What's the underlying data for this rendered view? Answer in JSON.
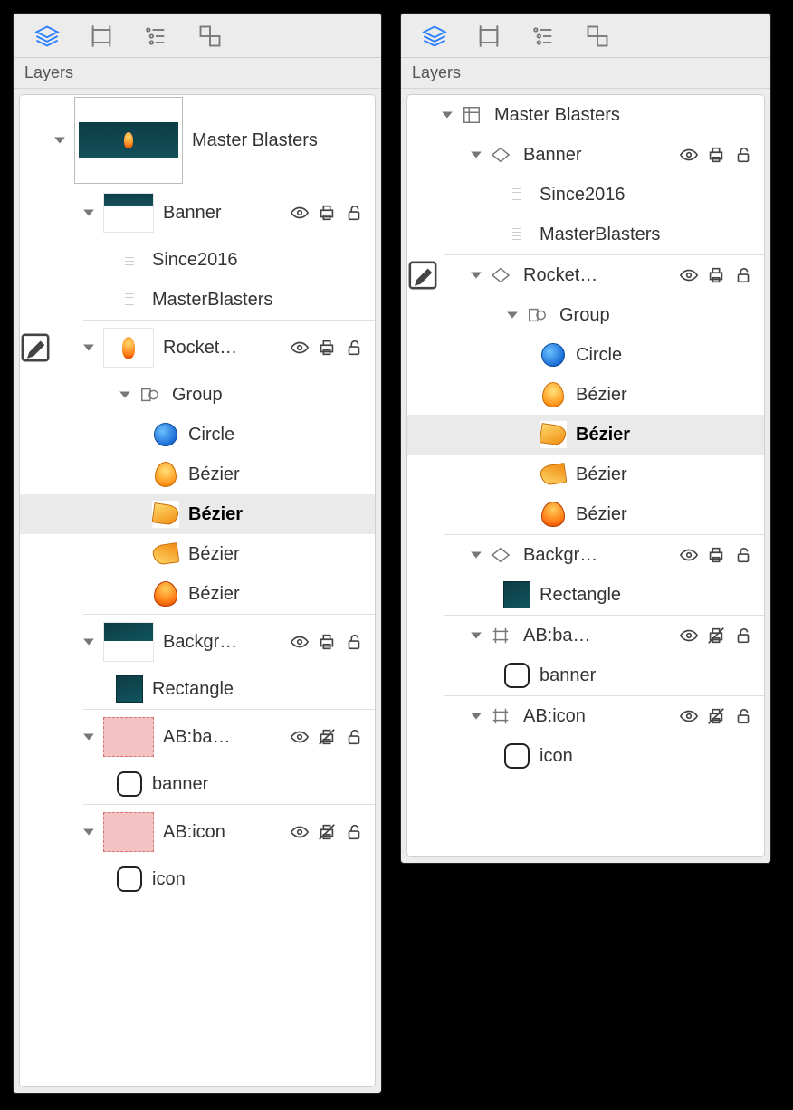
{
  "section_title": "Layers",
  "toolbar_icons": [
    "layers-icon",
    "artboard-icon",
    "outline-icon",
    "components-icon"
  ],
  "left": {
    "items": [
      {
        "id": "master",
        "label": "Master Blasters",
        "indent": 0,
        "disclosure": true,
        "thumb": "master-lg",
        "height": "tall"
      },
      {
        "id": "banner",
        "label": "Banner",
        "indent": 1,
        "disclosure": true,
        "thumb": "banner-md",
        "height": "med",
        "controls": [
          "eye",
          "print",
          "lock"
        ]
      },
      {
        "id": "since2016",
        "label": "Since2016",
        "indent": 2,
        "thumb": "text-mini"
      },
      {
        "id": "masterblasters",
        "label": "MasterBlasters",
        "indent": 2,
        "thumb": "text-mini"
      },
      {
        "id": "divider"
      },
      {
        "id": "rocket",
        "label": "Rocket…",
        "indent": 1,
        "disclosure": true,
        "thumb": "rocket-md",
        "height": "med",
        "editing": true,
        "controls": [
          "eye",
          "print",
          "lock"
        ]
      },
      {
        "id": "group",
        "label": "Group",
        "indent": 2,
        "disclosure": true,
        "type_icon": "group"
      },
      {
        "id": "circle",
        "label": "Circle",
        "indent": 3,
        "shape": "circle"
      },
      {
        "id": "bezier1",
        "label": "Bézier",
        "indent": 3,
        "shape": "drop"
      },
      {
        "id": "bezier2",
        "label": "Bézier",
        "indent": 3,
        "shape": "flame-l",
        "selected": true,
        "bold": true
      },
      {
        "id": "bezier3",
        "label": "Bézier",
        "indent": 3,
        "shape": "flame-r"
      },
      {
        "id": "bezier4",
        "label": "Bézier",
        "indent": 3,
        "shape": "fireball"
      },
      {
        "id": "divider"
      },
      {
        "id": "backgr",
        "label": "Backgr…",
        "indent": 1,
        "disclosure": true,
        "thumb": "bg-md",
        "height": "med",
        "controls": [
          "eye",
          "print",
          "lock"
        ]
      },
      {
        "id": "rectangle",
        "label": "Rectangle",
        "indent": 2,
        "shape": "rect-dark"
      },
      {
        "id": "divider"
      },
      {
        "id": "abba",
        "label": "AB:ba…",
        "indent": 1,
        "disclosure": true,
        "thumb": "pink",
        "height": "med",
        "controls": [
          "eye",
          "no-print",
          "lock"
        ]
      },
      {
        "id": "banner-slice",
        "label": "banner",
        "indent": 2,
        "shape": "roundrect"
      },
      {
        "id": "divider"
      },
      {
        "id": "abicon",
        "label": "AB:icon",
        "indent": 1,
        "disclosure": true,
        "thumb": "pink",
        "height": "med",
        "controls": [
          "eye",
          "no-print",
          "lock"
        ]
      },
      {
        "id": "icon-slice",
        "label": "icon",
        "indent": 2,
        "shape": "roundrect"
      }
    ]
  },
  "right": {
    "items": [
      {
        "id": "master",
        "label": "Master Blasters",
        "indent": 0,
        "disclosure": true,
        "type_icon": "canvas"
      },
      {
        "id": "banner",
        "label": "Banner",
        "indent": 1,
        "disclosure": true,
        "type_icon": "layer",
        "controls": [
          "eye",
          "print",
          "lock"
        ]
      },
      {
        "id": "since2016",
        "label": "Since2016",
        "indent": 2,
        "thumb": "text-mini"
      },
      {
        "id": "masterblasters",
        "label": "MasterBlasters",
        "indent": 2,
        "thumb": "text-mini"
      },
      {
        "id": "divider"
      },
      {
        "id": "rocket",
        "label": "Rocket…",
        "indent": 1,
        "disclosure": true,
        "type_icon": "layer",
        "editing": true,
        "controls": [
          "eye",
          "print",
          "lock"
        ]
      },
      {
        "id": "group",
        "label": "Group",
        "indent": 2,
        "disclosure": true,
        "type_icon": "group"
      },
      {
        "id": "circle",
        "label": "Circle",
        "indent": 3,
        "shape": "circle"
      },
      {
        "id": "bezier1",
        "label": "Bézier",
        "indent": 3,
        "shape": "drop"
      },
      {
        "id": "bezier2",
        "label": "Bézier",
        "indent": 3,
        "shape": "flame-l",
        "selected": true,
        "bold": true
      },
      {
        "id": "bezier3",
        "label": "Bézier",
        "indent": 3,
        "shape": "flame-r"
      },
      {
        "id": "bezier4",
        "label": "Bézier",
        "indent": 3,
        "shape": "fireball"
      },
      {
        "id": "divider"
      },
      {
        "id": "backgr",
        "label": "Backgr…",
        "indent": 1,
        "disclosure": true,
        "type_icon": "layer",
        "controls": [
          "eye",
          "print",
          "lock"
        ]
      },
      {
        "id": "rectangle",
        "label": "Rectangle",
        "indent": 2,
        "shape": "rect-dark"
      },
      {
        "id": "divider"
      },
      {
        "id": "abba",
        "label": "AB:ba…",
        "indent": 1,
        "disclosure": true,
        "type_icon": "slice",
        "controls": [
          "eye",
          "no-print",
          "lock"
        ]
      },
      {
        "id": "banner-slice",
        "label": "banner",
        "indent": 2,
        "shape": "roundrect"
      },
      {
        "id": "divider"
      },
      {
        "id": "abicon",
        "label": "AB:icon",
        "indent": 1,
        "disclosure": true,
        "type_icon": "slice",
        "controls": [
          "eye",
          "no-print",
          "lock"
        ]
      },
      {
        "id": "icon-slice",
        "label": "icon",
        "indent": 2,
        "shape": "roundrect"
      }
    ]
  }
}
